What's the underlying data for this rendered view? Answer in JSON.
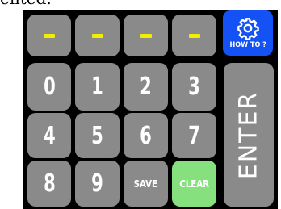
{
  "top_text": "ented.",
  "code_display": {
    "slots": [
      "-",
      "-",
      "-",
      "-"
    ],
    "dash_color": "#f2ee00"
  },
  "help_button": {
    "icon": "gear-icon",
    "label": "HOW TO ?",
    "color": "#1452f5"
  },
  "keypad": {
    "digits": [
      "0",
      "1",
      "2",
      "3",
      "4",
      "5",
      "6",
      "7",
      "8",
      "9"
    ],
    "save_label": "SAVE",
    "clear_label": "CLEAR",
    "enter_label": "ENTER",
    "key_color": "#8a8a8a",
    "clear_color": "#86e07d"
  }
}
